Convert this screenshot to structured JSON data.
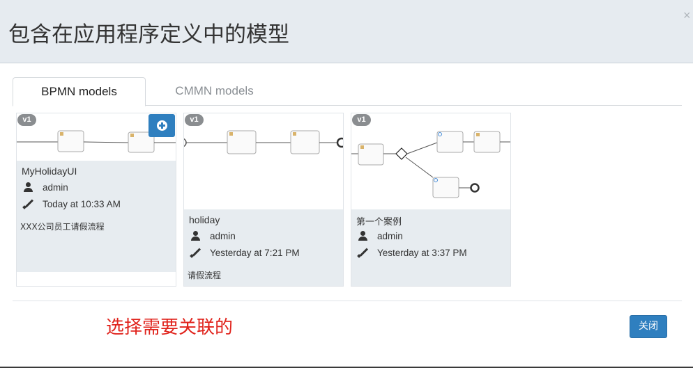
{
  "modal": {
    "title": "包含在应用程序定义中的模型",
    "close_glyph": "×"
  },
  "tabs": [
    {
      "label": "BPMN models",
      "active": true
    },
    {
      "label": "CMMN models",
      "active": false
    }
  ],
  "models": [
    {
      "version": "v1",
      "name": "MyHolidayUI",
      "owner": "admin",
      "modified": "Today at 10:33 AM",
      "description": "XXX公司员工请假流程",
      "add_button_icon": "plus-circle-icon"
    },
    {
      "version": "v1",
      "name": "holiday",
      "owner": "admin",
      "modified": "Yesterday at 7:21 PM",
      "description": "请假流程"
    },
    {
      "version": "v1",
      "name": "第一个案例",
      "owner": "admin",
      "modified": "Yesterday at 3:37 PM",
      "description": ""
    }
  ],
  "footer": {
    "annotation": "选择需要关联的",
    "close_label": "关闭"
  },
  "colors": {
    "header_bg": "#e6ebf0",
    "primary": "#2f7fbf",
    "info_bg": "#e7ecf0",
    "annotation": "#e0231c",
    "badge": "#8a8d90"
  }
}
